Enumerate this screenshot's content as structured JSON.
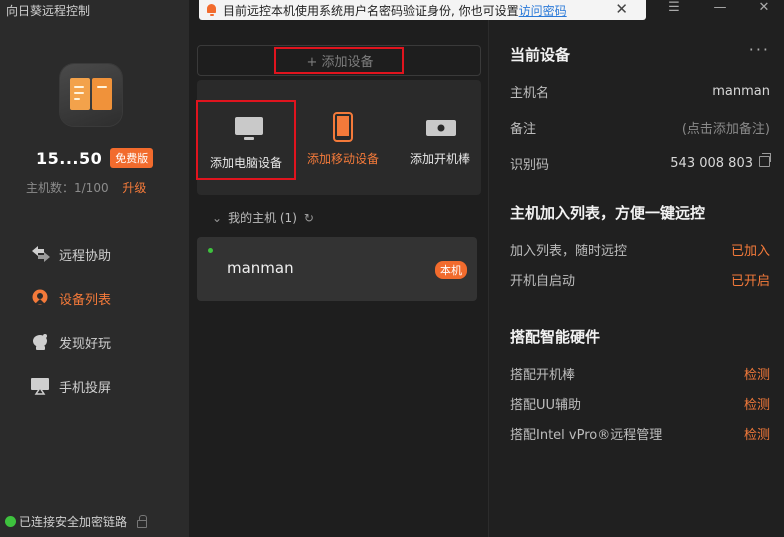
{
  "app": {
    "title": "向日葵远程控制"
  },
  "profile": {
    "user_id": "15...50",
    "plan_badge": "免费版",
    "host_count": "主机数：1/100",
    "upgrade_label": "升级"
  },
  "nav": {
    "items": [
      {
        "label": "远程协助",
        "icon": "remote-assist-icon"
      },
      {
        "label": "设备列表",
        "icon": "device-list-icon",
        "active": true
      },
      {
        "label": "发现好玩",
        "icon": "discover-icon"
      },
      {
        "label": "手机投屏",
        "icon": "cast-screen-icon"
      }
    ]
  },
  "status": {
    "connection": "已连接安全加密链路"
  },
  "notice": {
    "text": "目前远控本机使用系统用户名密码验证身份, 你也可设置",
    "link": "访问密码",
    "close": "✕"
  },
  "window": {
    "menu": "☰",
    "minimize": "—",
    "close": "✕"
  },
  "middle": {
    "add_device_label": "+ 添加设备",
    "tiles": [
      {
        "label": "添加电脑设备",
        "icon": "computer-icon"
      },
      {
        "label": "添加移动设备",
        "icon": "mobile-icon"
      },
      {
        "label": "添加开机棒",
        "icon": "power-stick-icon"
      }
    ],
    "group_label": "我的主机 (1)",
    "device": {
      "name": "manman",
      "tag": "本机",
      "online": true
    }
  },
  "right": {
    "current_title": "当前设备",
    "more": "···",
    "host_label": "主机名",
    "host_value": "manman",
    "note_label": "备注",
    "note_value": "(点击添加备注)",
    "id_label": "识别码",
    "id_value": "543 008 803",
    "list_title": "主机加入列表，方便一键远控",
    "join_label": "加入列表，随时远控",
    "join_value": "已加入",
    "boot_label": "开机自启动",
    "boot_value": "已开启",
    "hw_title": "搭配智能硬件",
    "hw": [
      {
        "label": "搭配开机棒",
        "action": "检测"
      },
      {
        "label": "搭配UU辅助",
        "action": "检测"
      },
      {
        "label": "搭配Intel vPro®远程管理",
        "action": "检测"
      }
    ]
  },
  "colors": {
    "accent": "#f47a3a",
    "highlight_box": "#e0141e",
    "online": "#3ec23e"
  }
}
